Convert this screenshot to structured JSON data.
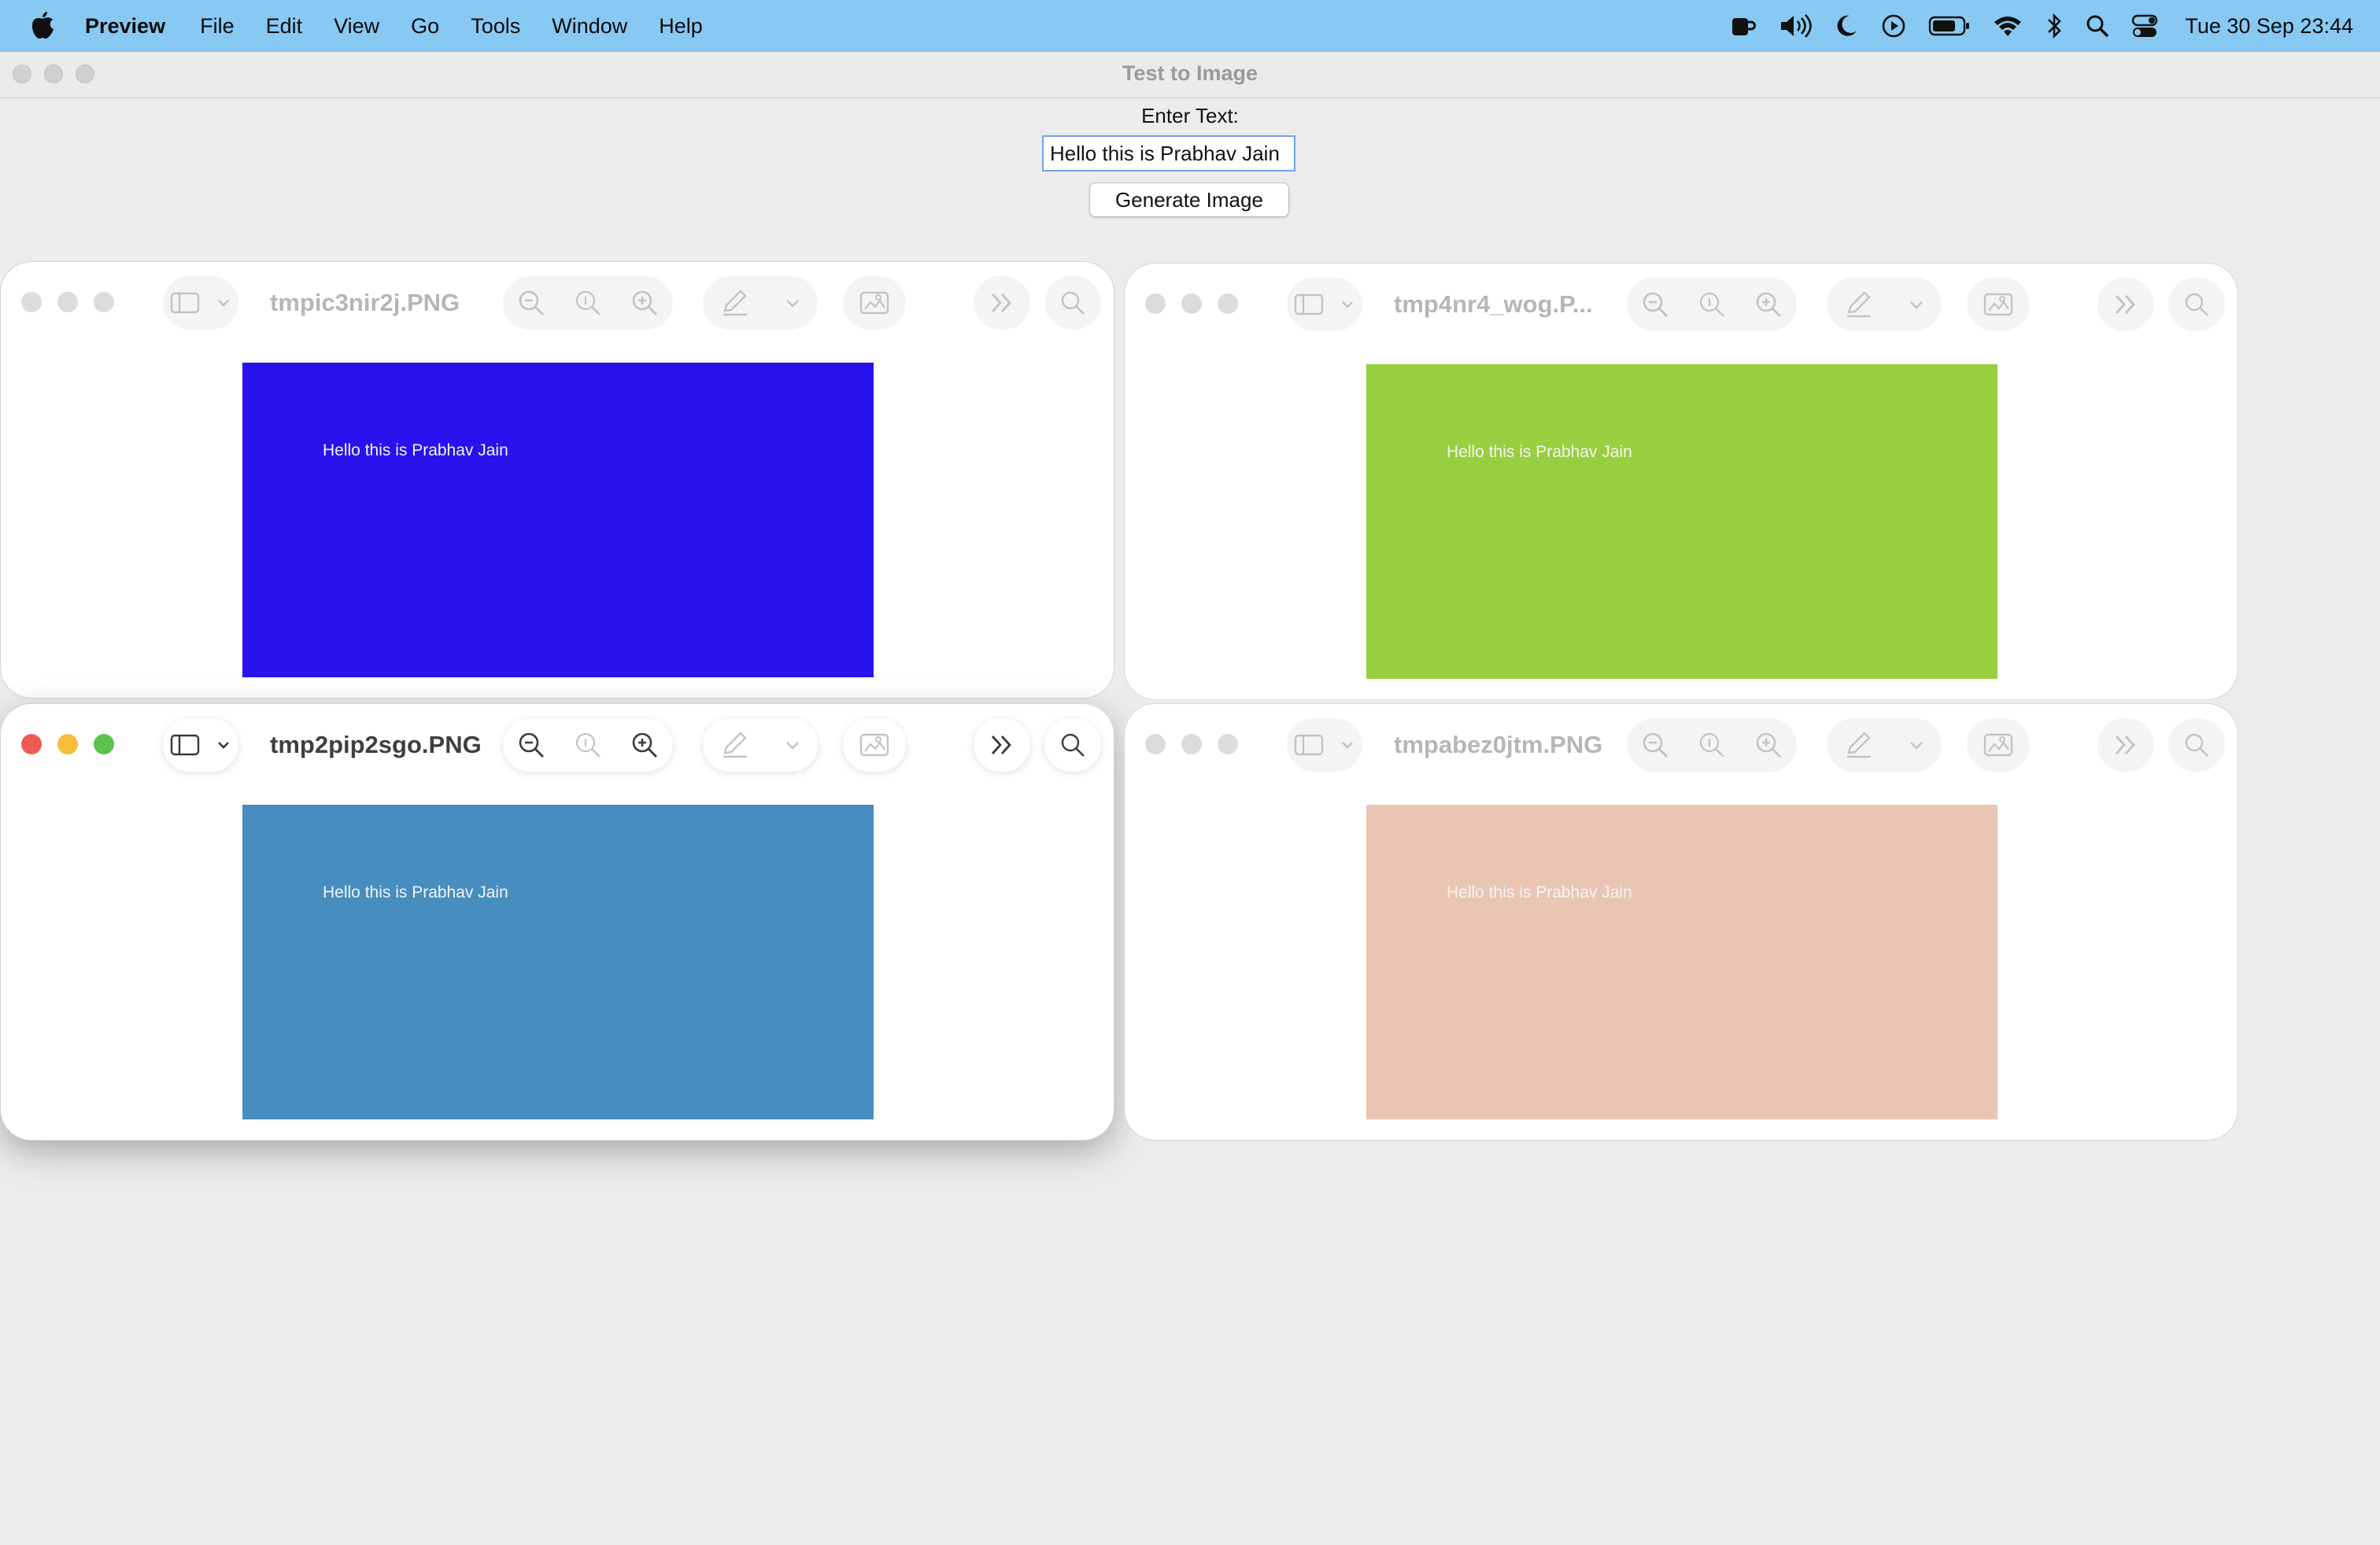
{
  "menubar": {
    "app_name": "Preview",
    "items": [
      "File",
      "Edit",
      "View",
      "Go",
      "Tools",
      "Window",
      "Help"
    ],
    "clock": "Tue 30 Sep  23:44",
    "status_icons": [
      "coffee-icon",
      "volume-icon",
      "moon-icon",
      "play-icon",
      "battery-icon",
      "wifi-icon",
      "bluetooth-icon",
      "search-icon",
      "control-center-icon"
    ]
  },
  "app": {
    "title": "Test to Image",
    "label": "Enter Text:",
    "input_value": "Hello this is Prabhav Jain",
    "button": "Generate Image"
  },
  "windows": [
    {
      "filename": "tmpic3nir2j.PNG",
      "bg": "#2a12ef",
      "image_text": "Hello this is Prabhav Jain",
      "active": false
    },
    {
      "filename": "tmp4nr4_wog.P...",
      "bg": "#98cf40",
      "image_text": "Hello this is Prabhav Jain",
      "active": false
    },
    {
      "filename": "tmp2pip2sgo.PNG",
      "bg": "#478dbf",
      "image_text": "Hello this is Prabhav Jain",
      "active": true
    },
    {
      "filename": "tmpabez0jtm.PNG",
      "bg": "#e9c6b3",
      "image_text": "Hello this is Prabhav Jain",
      "active": false
    }
  ]
}
